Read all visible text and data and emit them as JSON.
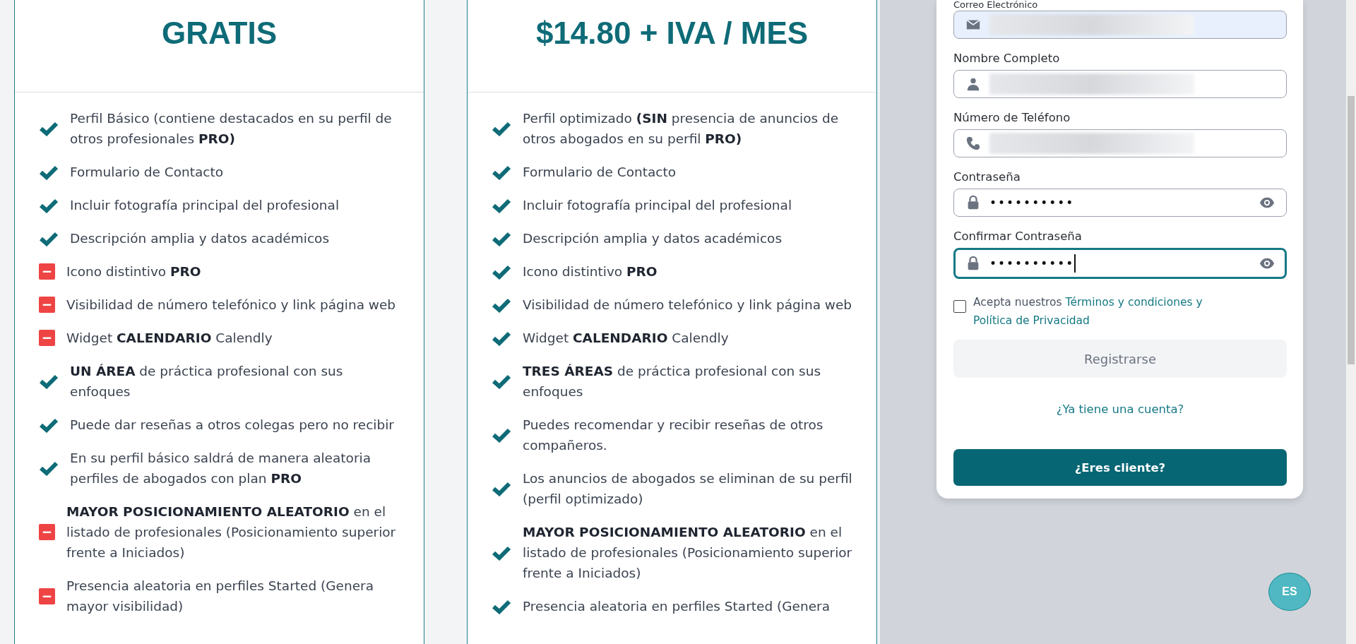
{
  "plans": [
    {
      "price": "GRATIS",
      "features": [
        {
          "text": "Perfil Básico (contiene destacados en su perfil de otros profesionales **PRO)**",
          "included": true
        },
        {
          "text": "Formulario de Contacto",
          "included": true
        },
        {
          "text": "Incluir fotografía principal del profesional",
          "included": true
        },
        {
          "text": "Descripción amplia y datos académicos",
          "included": true
        },
        {
          "text": "Icono distintivo **PRO**",
          "included": false
        },
        {
          "text": "Visibilidad de número telefónico y link página web",
          "included": false
        },
        {
          "text": "Widget **CALENDARIO** Calendly",
          "included": false
        },
        {
          "text": "**UN ÁREA** de práctica profesional con sus enfoques",
          "included": true
        },
        {
          "text": "Puede dar reseñas a otros colegas pero no recibir",
          "included": true
        },
        {
          "text": "En su perfil básico saldrá de manera aleatoria perfiles de abogados con plan **PRO**",
          "included": true
        },
        {
          "text": "**MAYOR POSICIONAMIENTO ALEATORIO** en el listado de profesionales (Posicionamiento superior frente a Iniciados)",
          "included": false
        },
        {
          "text": "Presencia aleatoria en perfiles Started (Genera mayor visibilidad)",
          "included": false
        }
      ]
    },
    {
      "price": "$14.80 + IVA / MES",
      "features": [
        {
          "text": "Perfil optimizado **(SIN** presencia de anuncios de otros abogados en su perfil **PRO)**",
          "included": true
        },
        {
          "text": "Formulario de Contacto",
          "included": true
        },
        {
          "text": "Incluir fotografía principal del profesional",
          "included": true
        },
        {
          "text": "Descripción amplia y datos académicos",
          "included": true
        },
        {
          "text": "Icono distintivo **PRO**",
          "included": true
        },
        {
          "text": "Visibilidad de número telefónico y link página web",
          "included": true
        },
        {
          "text": "Widget **CALENDARIO** Calendly",
          "included": true
        },
        {
          "text": "**TRES ÁREAS** de práctica profesional con sus enfoques",
          "included": true
        },
        {
          "text": "Puedes recomendar y recibir reseñas de otros compañeros.",
          "included": true
        },
        {
          "text": "Los anuncios de abogados se eliminan de su perfil (perfil optimizado)",
          "included": true
        },
        {
          "text": "**MAYOR POSICIONAMIENTO ALEATORIO** en el listado de profesionales (Posicionamiento superior frente a Iniciados)",
          "included": true
        },
        {
          "text": "Presencia aleatoria en perfiles Started (Genera",
          "included": true
        }
      ]
    }
  ],
  "form": {
    "fields": [
      {
        "label": "Correo Electrónico",
        "kind": "email",
        "autofilled": true,
        "focused": false
      },
      {
        "label": "Nombre Completo",
        "kind": "name",
        "autofilled": false,
        "focused": false
      },
      {
        "label": "Número de Teléfono",
        "kind": "phone",
        "autofilled": false,
        "focused": false
      },
      {
        "label": "Contraseña",
        "kind": "password",
        "value": "••••••••••",
        "autofilled": false,
        "focused": false
      },
      {
        "label": "Confirmar Contraseña",
        "kind": "password",
        "value": "••••••••••",
        "autofilled": false,
        "focused": true
      }
    ],
    "terms": {
      "checked": false,
      "text": "Acepta nuestros",
      "links": [
        "Términos y condiciones y",
        "Política de Privacidad"
      ]
    },
    "submit": {
      "label": "Registrarse",
      "disabled": true
    },
    "login_link": "¿Ya tiene una cuenta?",
    "client_button": "¿Eres cliente?"
  },
  "language_button": "ES"
}
